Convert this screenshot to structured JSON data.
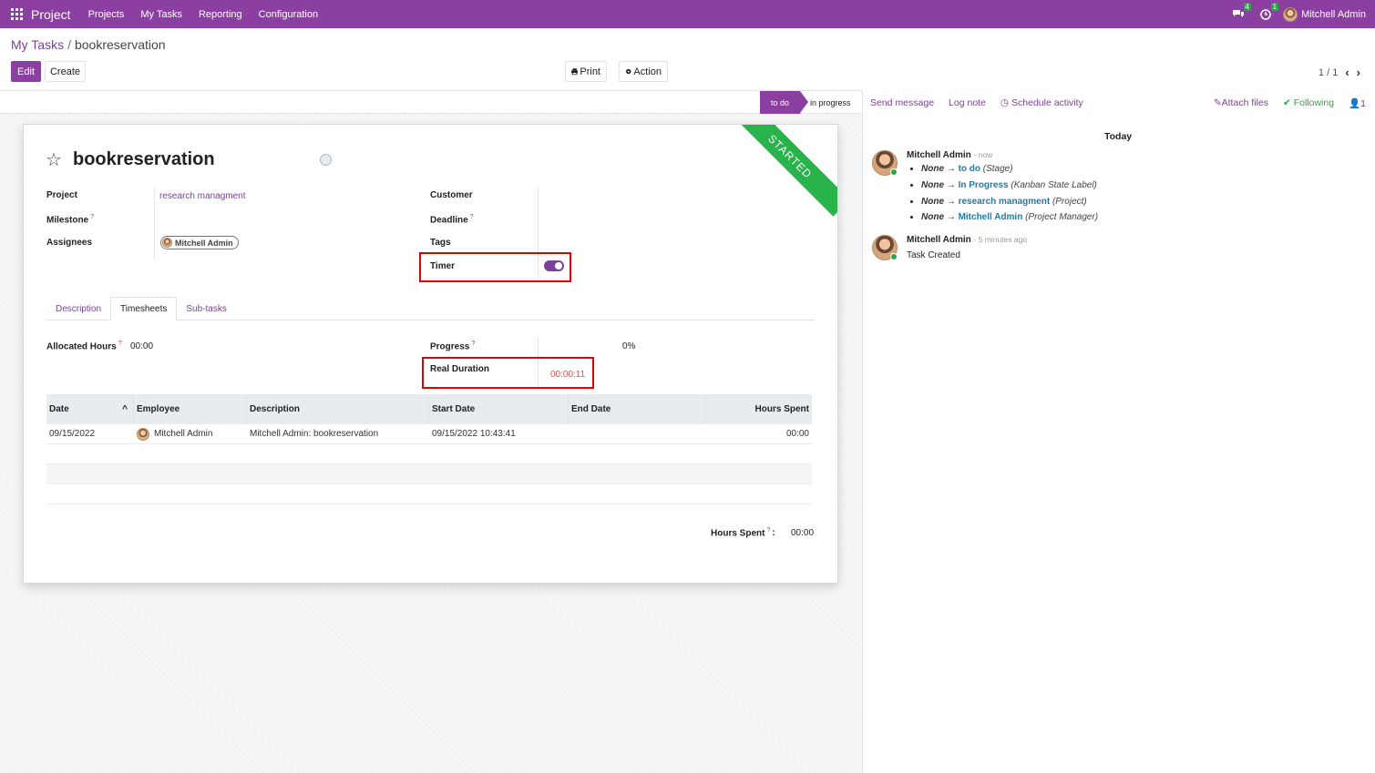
{
  "navbar": {
    "app_name": "Project",
    "menu": [
      "Projects",
      "My Tasks",
      "Reporting",
      "Configuration"
    ],
    "messages_badge": "4",
    "activities_badge": "1",
    "user": "Mitchell Admin"
  },
  "breadcrumb": {
    "parent": "My Tasks",
    "separator": "/",
    "current": "bookreservation"
  },
  "controls": {
    "edit": "Edit",
    "create": "Create",
    "print": "Print",
    "action": "Action",
    "pager": "1 / 1"
  },
  "status": {
    "active_stage": "to do",
    "next_stage": "in progress"
  },
  "record": {
    "title": "bookreservation",
    "ribbon": "STARTED",
    "labels": {
      "project": "Project",
      "milestone": "Milestone",
      "assignees": "Assignees",
      "customer": "Customer",
      "deadline": "Deadline",
      "tags": "Tags",
      "timer": "Timer"
    },
    "help_mark": "?",
    "project": "research managment",
    "assignee": "Mitchell Admin",
    "timer_on": true
  },
  "tabs": [
    "Description",
    "Timesheets",
    "Sub-tasks"
  ],
  "timesheet": {
    "allocated_label": "Allocated Hours",
    "allocated_value": "00:00",
    "progress_label": "Progress",
    "progress_value": "0%",
    "real_duration_label": "Real Duration",
    "real_duration_value": "00:00:11",
    "columns": [
      "Date",
      "Employee",
      "Description",
      "Start Date",
      "End Date",
      "Hours Spent"
    ],
    "sort_icon": "^",
    "rows": [
      {
        "date": "09/15/2022",
        "employee": "Mitchell Admin",
        "description": "Mitchell Admin: bookreservation",
        "start": "09/15/2022 10:43:41",
        "end": "",
        "hours": "00:00"
      }
    ],
    "total_label": "Hours Spent",
    "total_colon": ":",
    "total_value": "00:00"
  },
  "chatter": {
    "send_message": "Send message",
    "log_note": "Log note",
    "schedule_activity": "Schedule activity",
    "attach_files": "Attach files",
    "following": "Following",
    "followers_count": "1",
    "today": "Today",
    "messages": [
      {
        "author": "Mitchell Admin",
        "time": "- now",
        "changes": [
          {
            "old": "None",
            "arrow": "→",
            "new": "to do",
            "field": "(Stage)"
          },
          {
            "old": "None",
            "arrow": "→",
            "new": "In Progress",
            "field": "(Kanban State Label)"
          },
          {
            "old": "None",
            "arrow": "→",
            "new": "research managment",
            "field": "(Project)"
          },
          {
            "old": "None",
            "arrow": "→",
            "new": "Mitchell Admin",
            "field": "(Project Manager)"
          }
        ]
      },
      {
        "author": "Mitchell Admin",
        "time": "- 5 minutes ago",
        "body": "Task Created"
      }
    ]
  },
  "colors": {
    "brand": "#8b3fa0",
    "ribbon": "#28b34b",
    "highlight_box": "#e30000",
    "duration_text": "#d9534f"
  }
}
